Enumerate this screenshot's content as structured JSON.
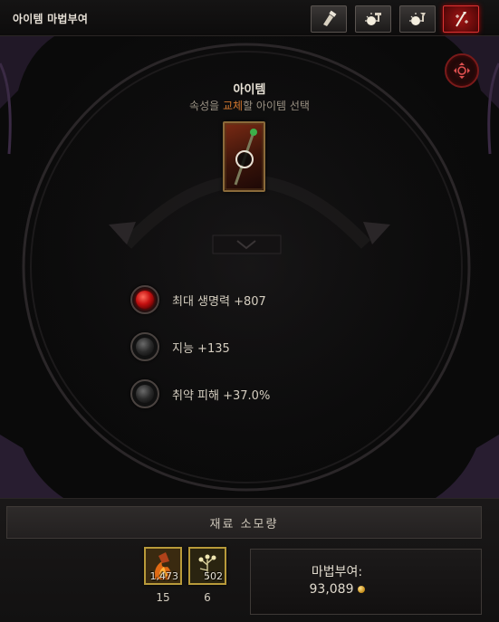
{
  "window": {
    "title": "아이템 마법부여"
  },
  "tabs": [
    {
      "icon": "hammer-enchant-icon",
      "active": false
    },
    {
      "icon": "gem-socket-icon",
      "active": false
    },
    {
      "icon": "gem-socket-alt-icon",
      "active": false
    },
    {
      "icon": "enchant-wand-icon",
      "active": true
    }
  ],
  "item_panel": {
    "title": "아이템",
    "subtitle_pre": "속성을 ",
    "subtitle_highlight": "교체",
    "subtitle_post": "할 아이템 선택",
    "item_icon": "staff-icon"
  },
  "stats": [
    {
      "text": "최대 생명력 +807",
      "gem": "red"
    },
    {
      "text": "지능 +135",
      "gem": "grey"
    },
    {
      "text": "취약 피해 +37.0%",
      "gem": "grey"
    }
  ],
  "materials": {
    "header": "재료 소모량",
    "items": [
      {
        "icon": "fire-material-icon",
        "owned": "1,473",
        "required": "15"
      },
      {
        "icon": "herb-material-icon",
        "owned": "502",
        "required": "6"
      }
    ]
  },
  "enchant": {
    "label": "마법부여:",
    "cost": "93,089",
    "currency_icon": "gold-icon"
  },
  "colors": {
    "accent_red": "#a11414",
    "highlight_orange": "#d0762e",
    "border_gold": "#b89a3a"
  }
}
